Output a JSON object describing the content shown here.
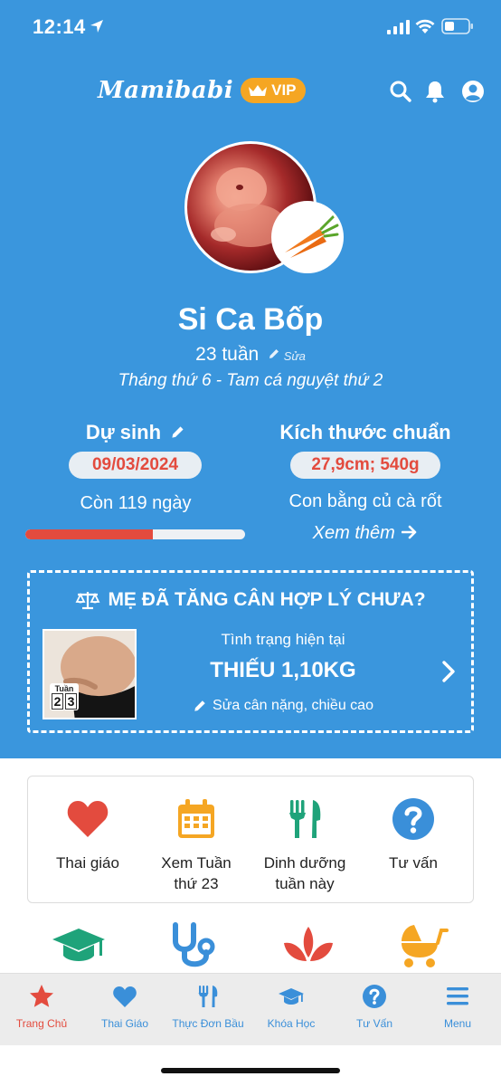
{
  "status_bar": {
    "time": "12:14"
  },
  "header": {
    "brand": "Mamibabi",
    "vip_label": "VIP"
  },
  "profile": {
    "name": "Si Ca Bốp",
    "weeks": "23 tuần",
    "edit_label": "Sửa",
    "trimester": "Tháng thứ 6 - Tam cá nguyệt thứ 2"
  },
  "due": {
    "title": "Dự sinh",
    "date": "09/03/2024",
    "remaining": "Còn 119 ngày",
    "progress": 0.58
  },
  "size": {
    "title": "Kích thước chuẩn",
    "value": "27,9cm; 540g",
    "compare": "Con bằng củ cà rốt",
    "more_label": "Xem thêm"
  },
  "weight": {
    "title": "MẸ ĐÃ TĂNG CÂN HỢP LÝ CHƯA?",
    "status_label": "Tình trạng hiện tại",
    "status_value": "THIẾU 1,10KG",
    "edit_label": "Sửa cân nặng, chiều cao",
    "week_tag_label": "Tuần",
    "week_digit_1": "2",
    "week_digit_2": "3"
  },
  "quick": {
    "item1": "Thai giáo",
    "item2_line1": "Xem Tuần",
    "item2_line2": "thứ 23",
    "item3_line1": "Dinh dưỡng",
    "item3_line2": "tuần này",
    "item4": "Tư vấn"
  },
  "tabs": {
    "home": "Trang Chủ",
    "prenatal": "Thai Giáo",
    "menu_food": "Thực Đơn Bầu",
    "courses": "Khóa Học",
    "consult": "Tư Vấn",
    "menu": "Menu"
  },
  "colors": {
    "primary_blue": "#3a96dd",
    "accent_red": "#e34b3e",
    "vip_orange": "#f5a623",
    "green": "#1fa37a"
  }
}
